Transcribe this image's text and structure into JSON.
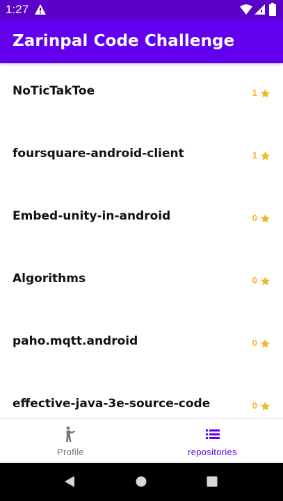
{
  "status_bar": {
    "time": "1:27",
    "icons": [
      "warning-icon",
      "wifi-icon",
      "signal-icon",
      "battery-icon"
    ]
  },
  "app_bar": {
    "title": "Zarinpal Code Challenge"
  },
  "repositories": [
    {
      "name": "NoTicTakToe",
      "stars": "1"
    },
    {
      "name": "foursquare-android-client",
      "stars": "1"
    },
    {
      "name": "Embed-unity-in-android",
      "stars": "0"
    },
    {
      "name": "Algorithms",
      "stars": "0"
    },
    {
      "name": "paho.mqtt.android",
      "stars": "0"
    },
    {
      "name": "effective-java-3e-source-code",
      "stars": "0"
    }
  ],
  "bottom_nav": {
    "items": [
      {
        "label": "Profile",
        "icon": "person-icon",
        "selected": false
      },
      {
        "label": "repositories",
        "icon": "list-icon",
        "selected": true
      }
    ]
  },
  "system_nav": {
    "icons": [
      "back-icon",
      "home-icon",
      "recents-icon"
    ]
  },
  "colors": {
    "primary": "#6200ee",
    "status_bar": "#5b00c9",
    "star": "#f5b623",
    "nav_inactive": "#757575"
  }
}
